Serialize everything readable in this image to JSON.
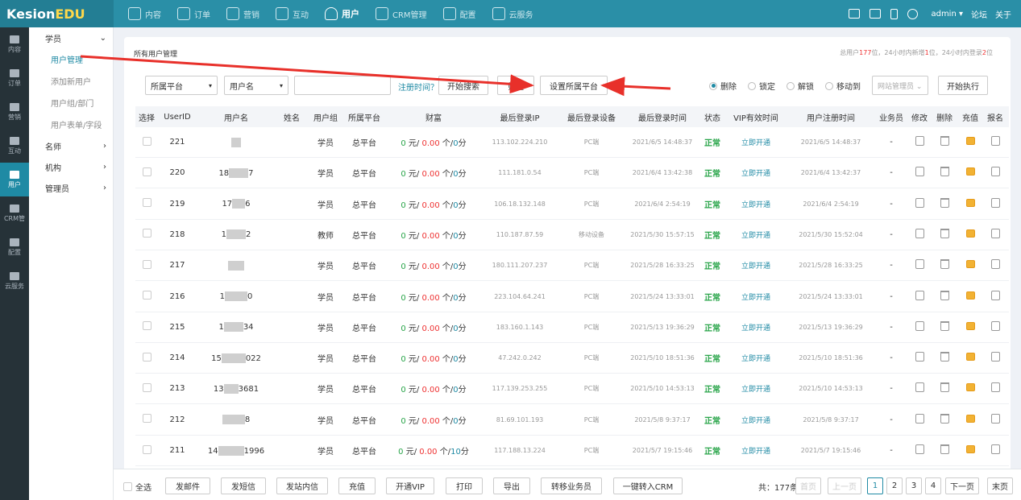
{
  "brand": {
    "name_a": "Kesion",
    "name_b": "EDU"
  },
  "nav": [
    {
      "label": "内容",
      "icon": "doc-list-icon"
    },
    {
      "label": "订单",
      "icon": "clipboard-icon"
    },
    {
      "label": "营销",
      "icon": "tag-icon"
    },
    {
      "label": "互动",
      "icon": "chat-icon"
    },
    {
      "label": "用户",
      "icon": "user-icon",
      "active": true
    },
    {
      "label": "CRM管理",
      "icon": "crm-icon"
    },
    {
      "label": "配置",
      "icon": "gear-icon"
    },
    {
      "label": "云服务",
      "icon": "cloud-icon"
    }
  ],
  "top_right": {
    "user": "admin ▾",
    "forum": "论坛",
    "about": "关于"
  },
  "iconcol": [
    {
      "label": "内容"
    },
    {
      "label": "订单"
    },
    {
      "label": "营销"
    },
    {
      "label": "互动"
    },
    {
      "label": "用户",
      "active": true
    },
    {
      "label": "CRM管"
    },
    {
      "label": "配置"
    },
    {
      "label": "云服务"
    }
  ],
  "sidebar": {
    "group1": "学员",
    "subs": [
      "用户管理",
      "添加新用户",
      "用户组/部门",
      "用户表单/字段"
    ],
    "groups": [
      "名师",
      "机构",
      "管理员"
    ]
  },
  "breadcrumb": "所有用户管理",
  "summary": {
    "p1": "总用户",
    "total": "177",
    "p2": "位，24小时内新增",
    "new": "1",
    "p3": "位，24小时内登录",
    "login": "2",
    "p4": "位"
  },
  "search": {
    "platform": "所属平台",
    "field": "用户名",
    "regtime": "注册时间？",
    "search_btn": "开始搜索",
    "filter_btn": "筛选",
    "set_platform_btn": "设置所属平台"
  },
  "actions": {
    "radios": [
      "删除",
      "锁定",
      "解锁",
      "移动到"
    ],
    "target_select": "网站管理员 ⌄",
    "exec_btn": "开始执行"
  },
  "table": {
    "headers": [
      "选择",
      "UserID",
      "用户名",
      "姓名",
      "用户组",
      "所属平台",
      "财富",
      "最后登录IP",
      "最后登录设备",
      "最后登录时间",
      "状态",
      "VIP有效时间",
      "用户注册时间",
      "业务员",
      "修改",
      "删除",
      "充值",
      "报名"
    ],
    "rows": [
      {
        "id": "221",
        "name_pre": "",
        "name_post": "",
        "group": "学员",
        "platform": "总平台",
        "yuan": "0",
        "bal": "0.00",
        "cnt": "0",
        "pts": "0",
        "ip": "113.102.224.210",
        "device": "PC端",
        "last": "2021/6/5 14:48:37",
        "status": "正常",
        "vip": "立即开通",
        "reg": "2021/6/5 14:48:37",
        "sales": "-"
      },
      {
        "id": "220",
        "name_pre": "18",
        "name_post": "7",
        "group": "学员",
        "platform": "总平台",
        "yuan": "0",
        "bal": "0.00",
        "cnt": "0",
        "pts": "0",
        "ip": "111.181.0.54",
        "device": "PC端",
        "last": "2021/6/4 13:42:38",
        "status": "正常",
        "vip": "立即开通",
        "reg": "2021/6/4 13:42:37",
        "sales": "-"
      },
      {
        "id": "219",
        "name_pre": "17",
        "name_post": "6",
        "group": "学员",
        "platform": "总平台",
        "yuan": "0",
        "bal": "0.00",
        "cnt": "0",
        "pts": "0",
        "ip": "106.18.132.148",
        "device": "PC端",
        "last": "2021/6/4 2:54:19",
        "status": "正常",
        "vip": "立即开通",
        "reg": "2021/6/4 2:54:19",
        "sales": "-"
      },
      {
        "id": "218",
        "name_pre": "1",
        "name_post": "2",
        "group": "教师",
        "platform": "总平台",
        "yuan": "0",
        "bal": "0.00",
        "cnt": "0",
        "pts": "0",
        "ip": "110.187.87.59",
        "device": "移动设备",
        "last": "2021/5/30 15:57:15",
        "status": "正常",
        "vip": "立即开通",
        "reg": "2021/5/30 15:52:04",
        "sales": "-"
      },
      {
        "id": "217",
        "name_pre": "",
        "name_post": "",
        "group": "学员",
        "platform": "总平台",
        "yuan": "0",
        "bal": "0.00",
        "cnt": "0",
        "pts": "0",
        "ip": "180.111.207.237",
        "device": "PC端",
        "last": "2021/5/28 16:33:25",
        "status": "正常",
        "vip": "立即开通",
        "reg": "2021/5/28 16:33:25",
        "sales": "-"
      },
      {
        "id": "216",
        "name_pre": "1",
        "name_post": "0",
        "group": "学员",
        "platform": "总平台",
        "yuan": "0",
        "bal": "0.00",
        "cnt": "0",
        "pts": "0",
        "ip": "223.104.64.241",
        "device": "PC端",
        "last": "2021/5/24 13:33:01",
        "status": "正常",
        "vip": "立即开通",
        "reg": "2021/5/24 13:33:01",
        "sales": "-"
      },
      {
        "id": "215",
        "name_pre": "1",
        "name_post": "34",
        "group": "学员",
        "platform": "总平台",
        "yuan": "0",
        "bal": "0.00",
        "cnt": "0",
        "pts": "0",
        "ip": "183.160.1.143",
        "device": "PC端",
        "last": "2021/5/13 19:36:29",
        "status": "正常",
        "vip": "立即开通",
        "reg": "2021/5/13 19:36:29",
        "sales": "-"
      },
      {
        "id": "214",
        "name_pre": "15",
        "name_post": "022",
        "group": "学员",
        "platform": "总平台",
        "yuan": "0",
        "bal": "0.00",
        "cnt": "0",
        "pts": "0",
        "ip": "47.242.0.242",
        "device": "PC端",
        "last": "2021/5/10 18:51:36",
        "status": "正常",
        "vip": "立即开通",
        "reg": "2021/5/10 18:51:36",
        "sales": "-"
      },
      {
        "id": "213",
        "name_pre": "13",
        "name_post": "3681",
        "group": "学员",
        "platform": "总平台",
        "yuan": "0",
        "bal": "0.00",
        "cnt": "0",
        "pts": "0",
        "ip": "117.139.253.255",
        "device": "PC端",
        "last": "2021/5/10 14:53:13",
        "status": "正常",
        "vip": "立即开通",
        "reg": "2021/5/10 14:53:13",
        "sales": "-"
      },
      {
        "id": "212",
        "name_pre": "",
        "name_post": "8",
        "group": "学员",
        "platform": "总平台",
        "yuan": "0",
        "bal": "0.00",
        "cnt": "0",
        "pts": "0",
        "ip": "81.69.101.193",
        "device": "PC端",
        "last": "2021/5/8 9:37:17",
        "status": "正常",
        "vip": "立即开通",
        "reg": "2021/5/8 9:37:17",
        "sales": "-"
      },
      {
        "id": "211",
        "name_pre": "14",
        "name_post": "1996",
        "group": "学员",
        "platform": "总平台",
        "yuan": "0",
        "bal": "0.00",
        "cnt": "0",
        "pts": "10",
        "ip": "117.188.13.224",
        "device": "PC端",
        "last": "2021/5/7 19:15:46",
        "status": "正常",
        "vip": "立即开通",
        "reg": "2021/5/7 19:15:46",
        "sales": "-"
      }
    ],
    "wealth_units": {
      "yuan": "元/",
      "cnt": "个/",
      "pts": "分"
    }
  },
  "bottom": {
    "select_all": "全选",
    "buttons": [
      "发邮件",
      "发短信",
      "发站内信",
      "充值",
      "开通VIP",
      "打印",
      "导出",
      "转移业务员",
      "一键转入CRM"
    ],
    "total": "共：177条",
    "first": "首页",
    "prev": "上一页",
    "pages": [
      "1",
      "2",
      "3",
      "4"
    ],
    "next": "下一页",
    "last": "末页"
  },
  "colors": {
    "brand": "#2a8fa7",
    "annotation_arrow": "#e8302a",
    "status_ok": "#2aa54a"
  }
}
